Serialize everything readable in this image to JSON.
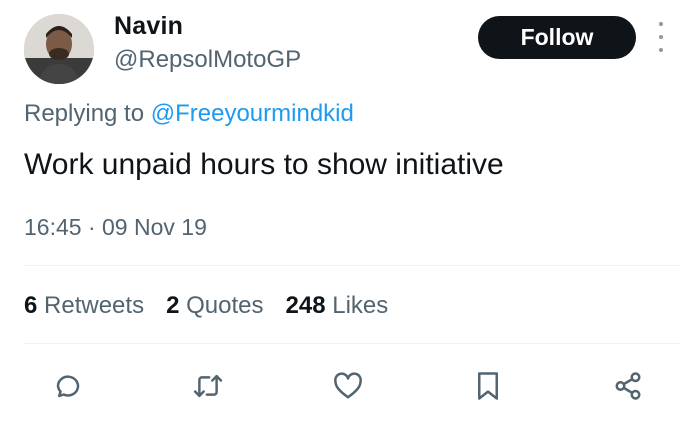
{
  "tweet": {
    "author_name": "Navin",
    "author_handle": "@RepsolMotoGP",
    "follow_label": "Follow",
    "replying_prefix": "Replying to",
    "replying_to": "@Freeyourmindkid",
    "text": "Work unpaid hours to show initiative",
    "time": "16:45",
    "separator": "·",
    "date": "09 Nov 19"
  },
  "stats": {
    "retweets_count": "6",
    "retweets_label": "Retweets",
    "quotes_count": "2",
    "quotes_label": "Quotes",
    "likes_count": "248",
    "likes_label": "Likes"
  },
  "actions": [
    {
      "icon": "reply-icon"
    },
    {
      "icon": "retweet-icon"
    },
    {
      "icon": "like-icon"
    },
    {
      "icon": "bookmark-icon"
    },
    {
      "icon": "share-icon"
    }
  ],
  "colors": {
    "accent": "#1d9bf0",
    "text": "#0f1419",
    "secondary": "#536471",
    "button_bg": "#0f1419"
  }
}
